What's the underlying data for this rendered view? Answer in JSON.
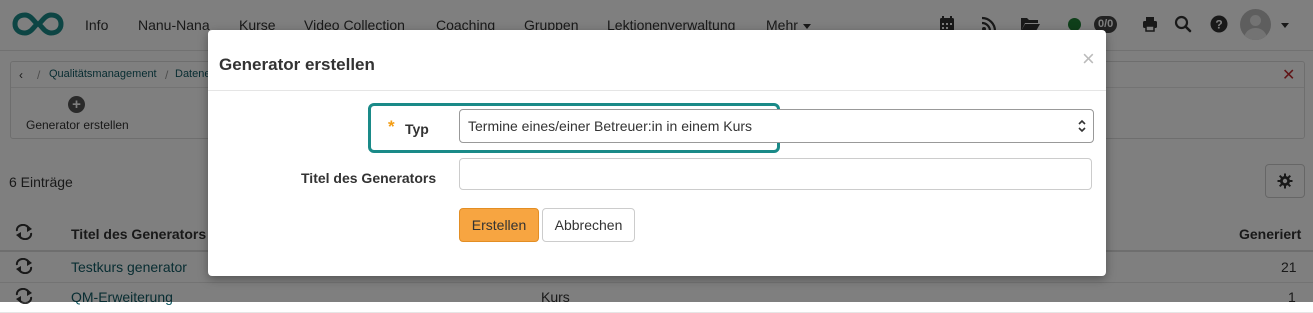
{
  "nav": {
    "items": [
      "Info",
      "Nanu-Nana",
      "Kurse",
      "Video Collection",
      "Coaching",
      "Gruppen",
      "Lektionenverwaltung",
      "Mehr"
    ],
    "status_count": "0/0"
  },
  "breadcrumb": {
    "items": [
      "Qualitätsmanagement",
      "Datene"
    ]
  },
  "toolbar": {
    "create_label": "Generator erstellen"
  },
  "list": {
    "count_text": "6 Einträge",
    "columns": [
      "Titel des Generators",
      "Generiert"
    ],
    "rows": [
      {
        "title": "Testkurs generator",
        "type": "",
        "generated": "21"
      },
      {
        "title": "QM-Erweiterung",
        "type": "Kurs",
        "generated": "1"
      }
    ]
  },
  "modal": {
    "title": "Generator erstellen",
    "type_label": "Typ",
    "type_value": "Termine eines/einer Betreuer:in in einem Kurs",
    "name_label": "Titel des Generators",
    "name_value": "",
    "create_button": "Erstellen",
    "cancel_button": "Abbrechen"
  },
  "colors": {
    "brand": "#1a8a88",
    "link": "#105a64",
    "primary_button": "#f7a541",
    "required_star": "#f39c12",
    "status_online": "#1e7f34",
    "close_red": "#c0282d"
  },
  "icons": [
    "openolat-logo-icon",
    "calendar-icon",
    "rss-icon",
    "folder-icon",
    "print-icon",
    "search-icon",
    "help-icon",
    "avatar-icon",
    "gear-icon",
    "cycle-icon",
    "close-icon",
    "plus-icon",
    "chevron-left-icon"
  ]
}
